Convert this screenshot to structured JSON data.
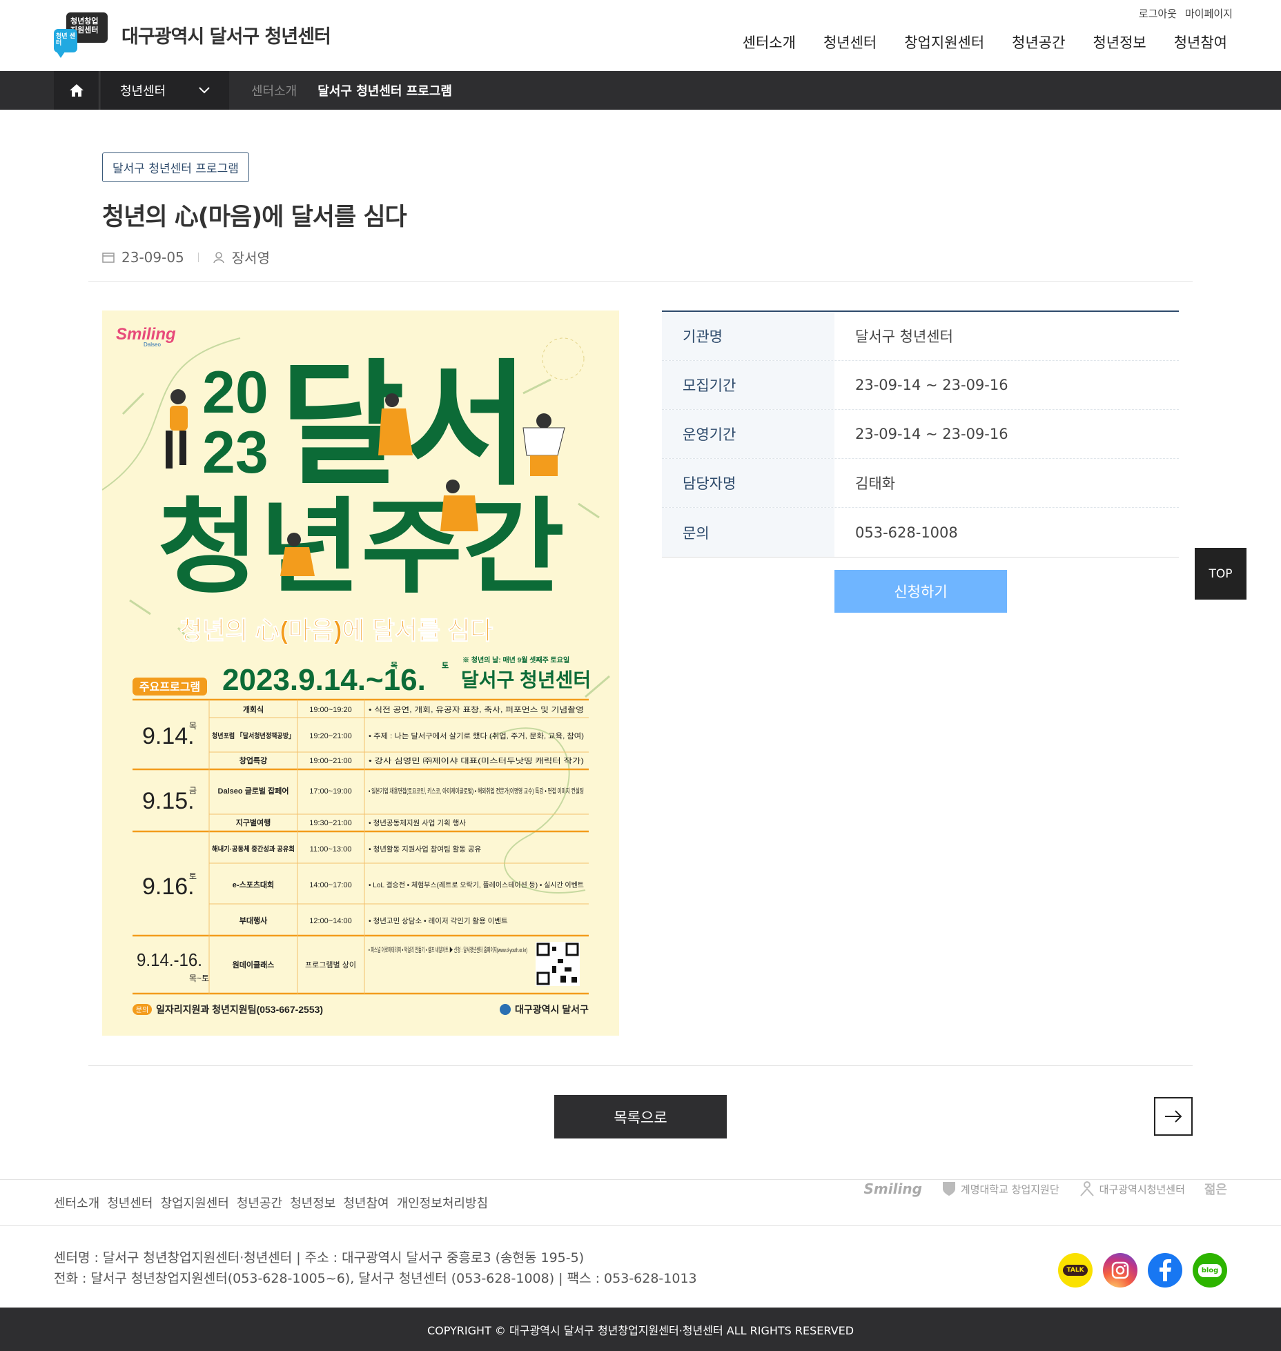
{
  "header": {
    "logo_text": "대구광역시 달서구 청년센터",
    "logo_badge_top": "청년창업 지원센터",
    "logo_badge_bottom": "청년 센터",
    "util": [
      "로그아웃",
      "마이페이지"
    ],
    "gnb": [
      "센터소개",
      "청년센터",
      "창업지원센터",
      "청년공간",
      "청년정보",
      "청년참여"
    ]
  },
  "location": {
    "depth_label": "청년센터",
    "crumbs": [
      "센터소개",
      "달서구 청년센터 프로그램"
    ]
  },
  "post": {
    "category": "달서구 청년센터 프로그램",
    "title": "청년의 心(마음)에 달서를 심다",
    "date": "23-09-05",
    "author": "장서영"
  },
  "poster": {
    "brand": "Smiling",
    "brand_sub": "Dalseo",
    "year_top": "20",
    "year_bottom": "23",
    "title_line1": "달서",
    "title_line2": "청년주간",
    "slogan": "청년의 心(마음)에 달서를 심다",
    "date_big": "2023.9.14.~16.",
    "date_day1": "목",
    "date_day2": "토",
    "note": "※ 청년의 날: 매년 9월 셋째주 토요일",
    "host": "달서구 청년센터",
    "program_tag": "주요프로그램",
    "rows": [
      {
        "day": "9.14.",
        "dow": "목",
        "items": [
          {
            "name": "개회식",
            "time": "19:00~19:20",
            "desc": "• 식전 공연, 개회, 유공자 표창, 축사, 퍼포먼스 및 기념촬영"
          },
          {
            "name": "청년포럼 「달서청년정책공방」",
            "time": "19:20~21:00",
            "desc": "• 주제 : 나는 달서구에서 살기로 했다 (취업, 주거, 문화, 교육, 참여)"
          },
          {
            "name": "창업특강",
            "time": "19:00~21:00",
            "desc": "• 강사 심영민 ㈜제이샤 대표(미스터두낫띵 캐릭터 작가)"
          }
        ]
      },
      {
        "day": "9.15.",
        "dow": "금",
        "items": [
          {
            "name": "Dalseo 글로벌 잡페어",
            "time": "17:00~19:00",
            "desc": "• 일본기업 채용면접(토요코인, 키스코, 아이제이글로벌) • 해외취업 전문가(이명영 교수) 특강 • 면접 이미지 컨설팅"
          },
          {
            "name": "지구별여행",
            "time": "19:30~21:00",
            "desc": "• 청년공동체지원 사업 기획 행사"
          }
        ]
      },
      {
        "day": "9.16.",
        "dow": "토",
        "items": [
          {
            "name": "해내기·공동체 중간성과 공유회",
            "time": "11:00~13:00",
            "desc": "• 청년활동 지원사업 참여팀 활동 공유"
          },
          {
            "name": "e-스포츠대회",
            "time": "14:00~17:00",
            "desc": "• LoL 결승전 • 체험부스(레트로 오락기, 플레이스테이션 등) • 실시간 이벤트"
          },
          {
            "name": "부대행사",
            "time": "12:00~14:00",
            "desc": "• 청년고민 상담소 • 레이저 각인기 활용 이벤트"
          }
        ]
      },
      {
        "day": "9.14.-16.",
        "dow": "목~토",
        "items": [
          {
            "name": "원데이클래스",
            "time": "프로그램별 상이",
            "desc": "• 퍼스널 아로마테라피 • 막걸리 만들기 • 셀프 네일아트 ▶ 신청 : 달서청년센터 홈페이지(www.d-youth.or.kr)"
          }
        ]
      }
    ],
    "contact_tag": "문의",
    "contact": "일자리지원과 청년지원팀(053-667-2553)",
    "org": "대구광역시 달서구",
    "colors": {
      "green": "#0c6b37",
      "orange": "#f39c1c",
      "bg": "#fdf7d3"
    }
  },
  "info": [
    {
      "label": "기관명",
      "value": "달서구 청년센터"
    },
    {
      "label": "모집기간",
      "value": "23-09-14 ~ 23-09-16"
    },
    {
      "label": "운영기간",
      "value": "23-09-14 ~ 23-09-16"
    },
    {
      "label": "담당자명",
      "value": "김태화"
    },
    {
      "label": "문의",
      "value": "053-628-1008"
    }
  ],
  "apply_label": "신청하기",
  "top_label": "TOP",
  "list_label": "목록으로",
  "footer": {
    "links": [
      "센터소개",
      "청년센터",
      "창업지원센터",
      "청년공간",
      "청년정보",
      "청년참여",
      "개인정보처리방침"
    ],
    "partners": [
      "Smiling",
      "계명대학교 창업지원단",
      "대구광역시청년센터",
      "젊은"
    ],
    "info_line1": "센터명 : 달서구 청년창업지원센터·청년센터 | 주소 : 대구광역시 달서구 중흥로3 (송현동 195-5)",
    "info_line2": "전화 : 달서구 청년창업지원센터(053-628-1005~6), 달서구 청년센터 (053-628-1008) | 팩스 : 053-628-1013",
    "sns": [
      "TALK",
      "instagram",
      "facebook",
      "blog"
    ],
    "copyright": "COPYRIGHT © 대구광역시 달서구 청년창업지원센터·청년센터 ALL RIGHTS RESERVED"
  }
}
